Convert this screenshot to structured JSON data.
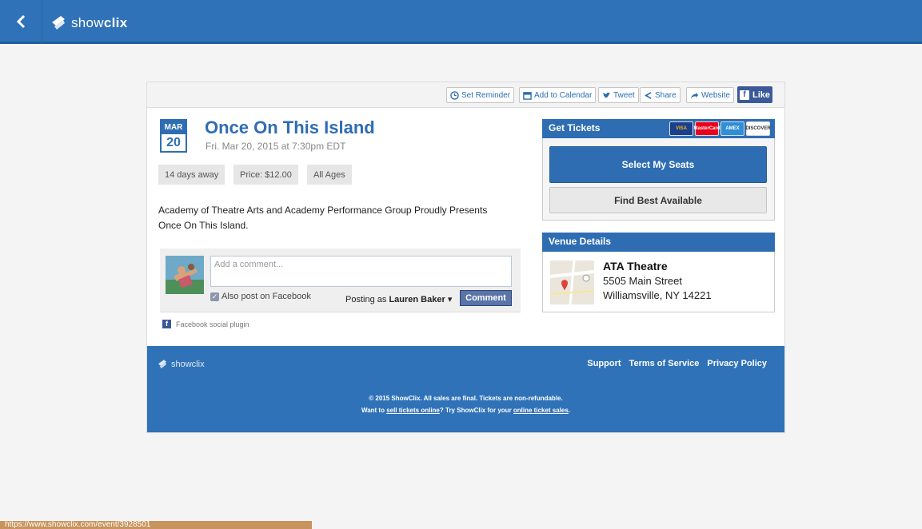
{
  "topbar": {
    "brand": {
      "prefix": "show",
      "suffix": "clix"
    }
  },
  "sharebar": {
    "set_reminder": "Set Reminder",
    "add_to_calendar": "Add to Calendar",
    "tweet": "Tweet",
    "share": "Share",
    "website": "Website",
    "like": "Like"
  },
  "event": {
    "month": "MAR",
    "day": "20",
    "title": "Once On This Island",
    "datetime": "Fri. Mar 20, 2015 at 7:30pm EDT",
    "pills": [
      "14 days away",
      "Price: $12.00",
      "All Ages"
    ],
    "description": "Academy of Theatre Arts and Academy Performance Group Proudly Presents Once On This Island."
  },
  "facebook": {
    "comment_placeholder": "Add a comment...",
    "also_post": "Also post on Facebook",
    "posting_as_prefix": "Posting as",
    "posting_as_name": "Lauren Baker",
    "comment_button": "Comment",
    "plugin_label": "Facebook social plugin"
  },
  "tickets": {
    "header": "Get Tickets",
    "cards": [
      {
        "label": "VISA",
        "bg": "#1a3f8f",
        "fg": "#f7b600"
      },
      {
        "label": "MasterCard",
        "bg": "#eb001b",
        "fg": "#ffffff"
      },
      {
        "label": "AMEX",
        "bg": "#2f8fd6",
        "fg": "#ffffff"
      },
      {
        "label": "DISCOVER",
        "bg": "#ffffff",
        "fg": "#333333"
      }
    ],
    "select_seats": "Select My Seats",
    "best_available": "Find Best Available"
  },
  "venue": {
    "header": "Venue Details",
    "name": "ATA Theatre",
    "street": "5505 Main Street",
    "city": "Williamsville, NY 14221"
  },
  "footer": {
    "brand": "showclix",
    "links": [
      "Support",
      "Terms of Service",
      "Privacy Policy"
    ],
    "copy_line1": "© 2015 ShowClix. All sales are final. Tickets are non-refundable.",
    "copy_line2_a": "Want to ",
    "copy_line2_link1": "sell tickets online",
    "copy_line2_b": "? Try ShowClix for your ",
    "copy_line2_link2": "online ticket sales",
    "copy_line2_c": "."
  },
  "status_bar": {
    "url": "https://www.showclix.com/event/3928501"
  },
  "colors": {
    "brand_blue": "#2f72b8",
    "accent_blue": "#2f6db3",
    "facebook_blue": "#3b5998"
  }
}
